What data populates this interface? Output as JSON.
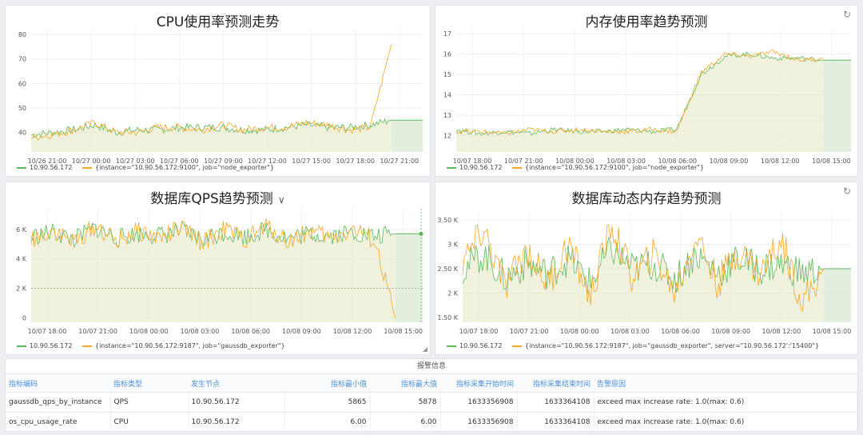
{
  "colors": {
    "series_a": "#5cb85c",
    "series_b": "#f5a623",
    "fill": "#e6e9c6",
    "forecast_fill": "#dcebd6",
    "header_text": "#4a90d9"
  },
  "panels": [
    {
      "title": "CPU使用率预测走势",
      "legend_a": "10.90.56.172",
      "legend_b": "{instance=\"10.90.56.172:9100\", job=\"node_exporter\"}"
    },
    {
      "title": "内存使用率趋势预测",
      "legend_a": "10.90.56.172",
      "legend_b": "{instance=\"10.90.56.172:9100\", job=\"node_exporter\"}"
    },
    {
      "title": "数据库QPS趋势预测",
      "legend_a": "10.90.56.172",
      "legend_b": "{instance=\"10.90.56.172:9187\", job=\"gaussdb_exporter\"}"
    },
    {
      "title": "数据库动态内存趋势预测",
      "legend_a": "10.90.56.172",
      "legend_b": "{instance=\"10.90.56.172:9187\", job=\"gaussdb_exporter\", server=\"10.90.56.172':'15400\"}"
    }
  ],
  "chart_data": [
    {
      "type": "line",
      "title": "CPU使用率预测走势",
      "ylim": [
        32,
        82
      ],
      "yticks": [
        "40",
        "50",
        "60",
        "70",
        "80"
      ],
      "ytick_values": [
        40,
        50,
        60,
        70,
        80
      ],
      "xticks": [
        "10/26 21:00",
        "10/27 00:00",
        "10/27 03:00",
        "10/27 06:00",
        "10/27 09:00",
        "10/27 12:00",
        "10/27 15:00",
        "10/27 18:00",
        "10/27 21:00"
      ],
      "series": [
        {
          "name": "10.90.56.172",
          "values": [
            39,
            40,
            41,
            43,
            40,
            41,
            41,
            42,
            42,
            42,
            41,
            41,
            42,
            43,
            42,
            42,
            43,
            45
          ]
        },
        {
          "name": "{instance=\"10.90.56.172:9100\", job=\"node_exporter\"}",
          "values": [
            38,
            39,
            41,
            44,
            40,
            40,
            42,
            42,
            41,
            43,
            41,
            42,
            42,
            44,
            43,
            41,
            42,
            76
          ]
        }
      ]
    },
    {
      "type": "line",
      "title": "内存使用率趋势预测",
      "ylim": [
        11.2,
        17.2
      ],
      "yticks": [
        "12",
        "13",
        "14",
        "15",
        "16",
        "17"
      ],
      "ytick_values": [
        12,
        13,
        14,
        15,
        16,
        17
      ],
      "xticks": [
        "10/07 18:00",
        "10/07 21:00",
        "10/08 00:00",
        "10/08 03:00",
        "10/08 06:00",
        "10/08 09:00",
        "10/08 12:00",
        "10/08 15:00"
      ],
      "series": [
        {
          "name": "10.90.56.172",
          "values": [
            12.3,
            12.1,
            12.2,
            12.1,
            12.3,
            12.2,
            12.2,
            12.3,
            12.2,
            12.3,
            15.0,
            15.9,
            16.0,
            15.8,
            15.8,
            15.7
          ]
        },
        {
          "name": "{instance=\"10.90.56.172:9100\", job=\"node_exporter\"}",
          "values": [
            12.2,
            12.2,
            12.1,
            12.3,
            12.2,
            12.3,
            12.2,
            12.2,
            12.3,
            12.2,
            15.1,
            16.0,
            15.9,
            16.1,
            15.7,
            15.8
          ]
        }
      ]
    },
    {
      "type": "line",
      "title": "数据库QPS趋势预测",
      "ylim": [
        -300,
        7400
      ],
      "yticks": [
        "0",
        "2 K",
        "4 K",
        "6 K"
      ],
      "ytick_values": [
        0,
        2000,
        4000,
        6000
      ],
      "xticks": [
        "10/07 18:00",
        "10/07 21:00",
        "10/08 00:00",
        "10/08 03:00",
        "10/08 06:00",
        "10/08 09:00",
        "10/08 12:00",
        "10/08 15:00"
      ],
      "series": [
        {
          "name": "10.90.56.172",
          "values": [
            5500,
            5800,
            5300,
            6100,
            5400,
            5700,
            5600,
            5900,
            5300,
            5800,
            5500,
            6000,
            5400,
            5700,
            5600,
            5800,
            5500,
            5700
          ]
        },
        {
          "name": "{instance=\"10.90.56.172:9187\", job=\"gaussdb_exporter\"}",
          "values": [
            5300,
            6000,
            5100,
            6200,
            5200,
            5900,
            5400,
            6100,
            5100,
            6000,
            5300,
            6200,
            5200,
            5900,
            5400,
            6000,
            5300,
            0
          ]
        }
      ]
    },
    {
      "type": "line",
      "title": "数据库动态内存趋势预测",
      "ylim": [
        1.4,
        3.65
      ],
      "yticks": [
        "1.50 K",
        "2 K",
        "2.50 K",
        "3 K",
        "3.50 K"
      ],
      "ytick_values": [
        1.5,
        2,
        2.5,
        3,
        3.5
      ],
      "xticks": [
        "10/07 18:00",
        "10/07 21:00",
        "10/08 00:00",
        "10/08 03:00",
        "10/08 06:00",
        "10/08 09:00",
        "10/08 12:00",
        "10/08 15:00"
      ],
      "series": [
        {
          "name": "10.90.56.172",
          "values": [
            2.5,
            2.8,
            2.3,
            2.6,
            2.4,
            2.7,
            2.2,
            2.9,
            2.5,
            2.6,
            2.3,
            2.8,
            2.4,
            2.7,
            2.5,
            2.6,
            2.4,
            2.5
          ]
        },
        {
          "name": "{instance=\"10.90.56.172:9187\", job=\"gaussdb_exporter\", server=\"10.90.56.172':'15400\"}",
          "values": [
            2.6,
            3.3,
            2.1,
            2.9,
            2.2,
            3.0,
            1.9,
            3.4,
            2.3,
            2.8,
            2.0,
            3.2,
            2.2,
            2.9,
            2.4,
            3.1,
            1.8,
            2.5
          ]
        }
      ]
    }
  ],
  "alarm": {
    "title": "报警信息",
    "headers": [
      "指标编码",
      "指标类型",
      "发生节点",
      "指标最小值",
      "指标最大值",
      "指标采集开始时间",
      "指标采集结束时间",
      "告警原因"
    ],
    "rows": [
      [
        "gaussdb_qps_by_instance",
        "QPS",
        "10.90.56.172",
        "5865",
        "5878",
        "1633356908",
        "1633364108",
        "exceed max increase rate: 1.0(max: 0.6)"
      ],
      [
        "os_cpu_usage_rate",
        "CPU",
        "10.90.56.172",
        "6.00",
        "6.00",
        "1633356908",
        "1633364108",
        "exceed max increase rate: 1.0(max: 0.6)"
      ]
    ]
  }
}
